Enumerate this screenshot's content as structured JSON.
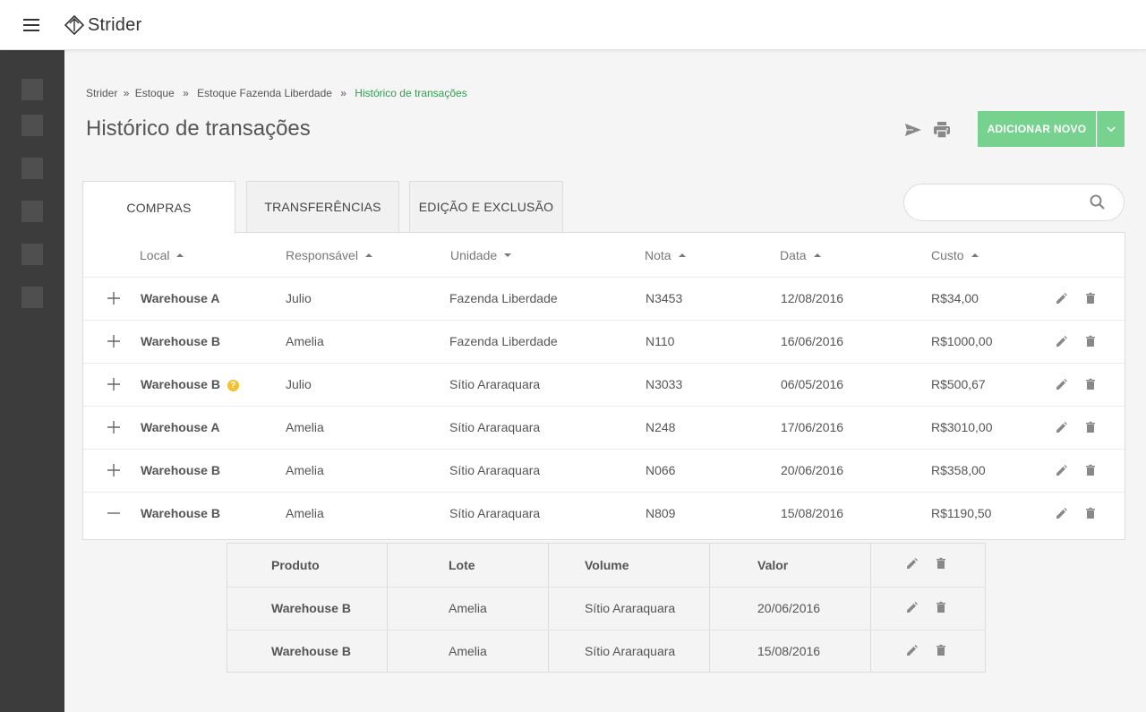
{
  "app": {
    "name": "Strider"
  },
  "breadcrumb": [
    "Strider",
    "Estoque",
    "Estoque Fazenda Liberdade",
    "Histórico de transações"
  ],
  "breadcrumb_seps": [
    "»",
    "»",
    "»"
  ],
  "page": {
    "title": "Histórico de transações"
  },
  "actions": {
    "add_label": "ADICIONAR NOVO"
  },
  "tabs": [
    "COMPRAS",
    "TRANSFERÊNCIAS",
    "EDIÇÃO E EXCLUSÃO"
  ],
  "active_tab": "COMPRAS",
  "search": {
    "placeholder": "",
    "value": ""
  },
  "table": {
    "columns": [
      "Local",
      "Responsável",
      "Unidade",
      "Nota",
      "Data",
      "Custo"
    ],
    "sort_directions": [
      "up",
      "up",
      "down",
      "up",
      "up",
      "up"
    ],
    "rows": [
      {
        "local": "Warehouse A",
        "responsavel": "Julio",
        "unidade": "Fazenda Liberdade",
        "nota": "N3453",
        "data": "12/08/2016",
        "custo": "R$34,00"
      },
      {
        "local": "Warehouse B",
        "responsavel": "Amelia",
        "unidade": "Fazenda Liberdade",
        "nota": "N110",
        "data": "16/06/2016",
        "custo": "R$1000,00"
      },
      {
        "local": "Warehouse B",
        "responsavel": "Julio",
        "unidade": "Sítio Araraquara",
        "nota": "N3033",
        "data": "06/05/2016",
        "custo": "R$500,67",
        "warning": "?"
      },
      {
        "local": "Warehouse A",
        "responsavel": "Amelia",
        "unidade": "Sítio Araraquara",
        "nota": "N248",
        "data": "17/06/2016",
        "custo": "R$3010,00"
      },
      {
        "local": "Warehouse B",
        "responsavel": "Amelia",
        "unidade": "Sítio Araraquara",
        "nota": "N066",
        "data": "20/06/2016",
        "custo": "R$358,00"
      },
      {
        "local": "Warehouse B",
        "responsavel": "Amelia",
        "unidade": "Sítio Araraquara",
        "nota": "N809",
        "data": "15/08/2016",
        "custo": "R$1190,50",
        "expanded": true
      }
    ]
  },
  "subtable": {
    "columns": [
      "Produto",
      "Lote",
      "Volume",
      "Valor"
    ],
    "rows": [
      {
        "produto": "Warehouse B",
        "lote": "Amelia",
        "volume": "Sítio Araraquara",
        "valor": "20/06/2016"
      },
      {
        "produto": "Warehouse B",
        "lote": "Amelia",
        "volume": "Sítio Araraquara",
        "valor": "15/08/2016"
      }
    ]
  },
  "colors": {
    "accent": "#77d18f",
    "breadcrumb_active": "#2e9e4f",
    "sidebar": "#3c3c3c",
    "warning": "#f2c12e"
  },
  "icons": [
    "menu-icon",
    "strider-logo-icon",
    "send-icon",
    "print-icon",
    "chevron-down-icon",
    "search-icon",
    "plus-icon",
    "minus-icon",
    "edit-icon",
    "delete-icon",
    "help-icon"
  ]
}
